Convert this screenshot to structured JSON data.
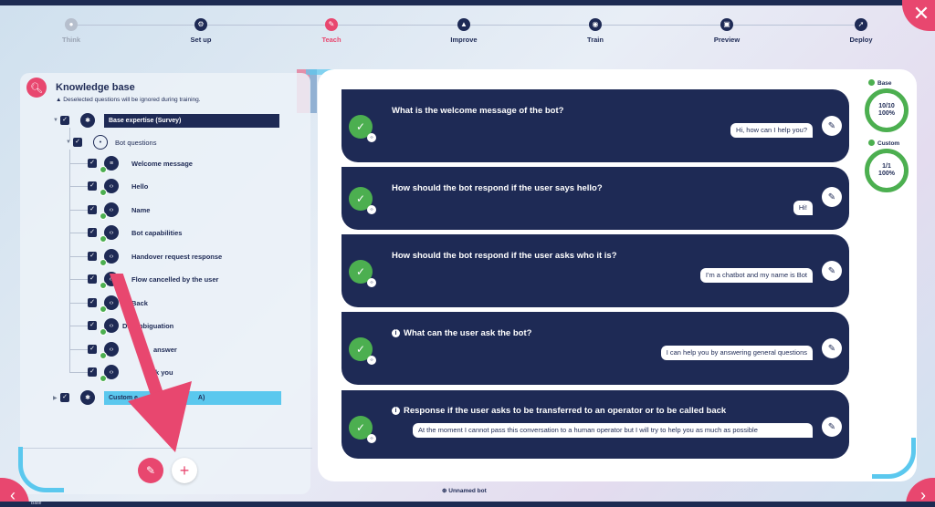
{
  "steps": [
    {
      "label": "Think",
      "state": "muted",
      "icon": "lightbulb-icon"
    },
    {
      "label": "Set up",
      "state": "done",
      "icon": "gear-icon"
    },
    {
      "label": "Teach",
      "state": "active",
      "icon": "pencil-icon"
    },
    {
      "label": "Improve",
      "state": "done",
      "icon": "mountain-icon"
    },
    {
      "label": "Train",
      "state": "done",
      "icon": "brain-icon"
    },
    {
      "label": "Preview",
      "state": "done",
      "icon": "preview-icon"
    },
    {
      "label": "Deploy",
      "state": "done",
      "icon": "rocket-icon"
    }
  ],
  "knowledge_base": {
    "title": "Knowledge base",
    "warning": "Deselected questions will be ignored during training.",
    "root": "Base expertise (Survey)",
    "group": "Bot questions",
    "items": [
      "Welcome message",
      "Hello",
      "Name",
      "Bot capabilities",
      "Handover request response",
      "Flow cancelled by the user",
      "Back",
      "Disambiguation",
      "answer",
      "k you"
    ],
    "custom_partial_left": "Custom e",
    "custom_partial_right": "A)"
  },
  "qa": [
    {
      "question": "What is the welcome message of the bot?",
      "answer": "Hi, how can I help you?",
      "info": false
    },
    {
      "question": "How should the bot respond if the user says hello?",
      "answer": "Hi!",
      "info": false
    },
    {
      "question": "How should the bot respond if the user asks who it is?",
      "answer": "I'm a chatbot and my name is Bot",
      "info": false
    },
    {
      "question": "What can the user ask the bot?",
      "answer": "I can help you by answering general questions",
      "info": true
    },
    {
      "question": "Response if the user asks to be transferred to an operator or to be called back",
      "answer": "At the moment I cannot pass this conversation to a human operator but I will try to help you as much as possible",
      "info": true
    }
  ],
  "gauges": [
    {
      "label": "Base",
      "count": "10/10",
      "percent": "100%"
    },
    {
      "label": "Custom",
      "count": "1/1",
      "percent": "100%"
    }
  ],
  "footer": {
    "bot_name": "Unnamed bot",
    "strip_text": "Base"
  },
  "colors": {
    "accent": "#e8476f",
    "navy": "#1e2a55",
    "success": "#4caf50",
    "cyan": "#5bc8ee"
  }
}
